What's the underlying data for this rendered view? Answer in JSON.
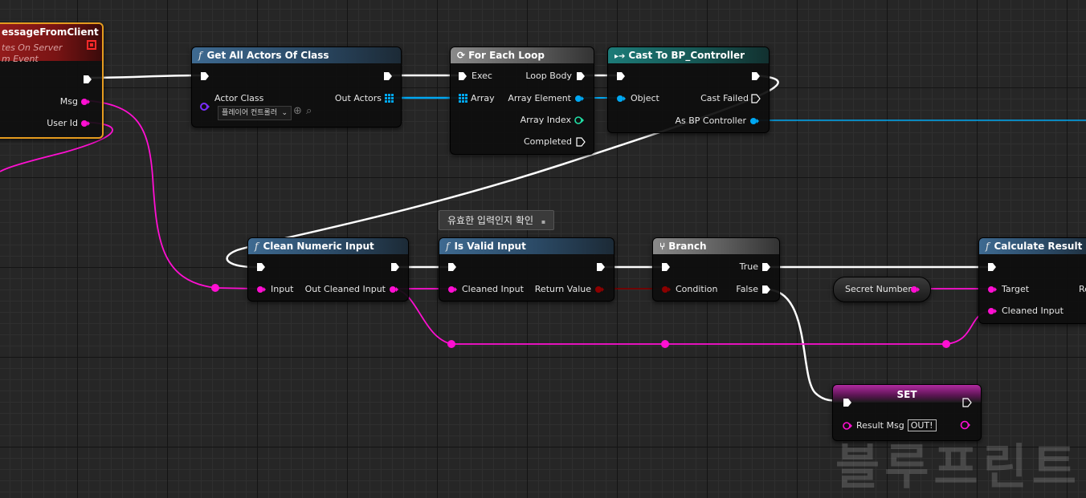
{
  "colors": {
    "exec": "#ffffff",
    "string": "#ff0fd2",
    "object": "#00a8f2",
    "int": "#21e0a6",
    "bool": "#8c0000",
    "class": "#5b00cc"
  },
  "event_node": {
    "title": "essageFromClient",
    "subtitle1": "tes On Server",
    "subtitle2": "m Event",
    "pin_msg": "Msg",
    "pin_user_id": "User Id"
  },
  "get_all_actors": {
    "title": "Get All Actors Of Class",
    "pin_actor_class": "Actor Class",
    "actor_class_value": "플레이어 컨트롤러",
    "pin_out_actors": "Out Actors"
  },
  "for_each": {
    "title": "For Each Loop",
    "pin_exec": "Exec",
    "pin_array": "Array",
    "pin_loop_body": "Loop Body",
    "pin_array_element": "Array Element",
    "pin_array_index": "Array Index",
    "pin_completed": "Completed"
  },
  "cast": {
    "title": "Cast To BP_Controller",
    "pin_object": "Object",
    "pin_cast_failed": "Cast Failed",
    "pin_as_bp": "As BP Controller"
  },
  "clean_input": {
    "title": "Clean Numeric Input",
    "pin_input": "Input",
    "pin_out_cleaned": "Out Cleaned Input"
  },
  "comment_tooltip": "유효한 입력인지 확인",
  "is_valid": {
    "title": "Is Valid Input",
    "pin_cleaned": "Cleaned Input",
    "pin_return": "Return Value"
  },
  "branch": {
    "title": "Branch",
    "pin_condition": "Condition",
    "pin_true": "True",
    "pin_false": "False"
  },
  "secret_number": {
    "label": "Secret Number"
  },
  "calculate": {
    "title": "Calculate Result",
    "pin_target": "Target",
    "pin_cleaned": "Cleaned Input",
    "pin_re": "Re"
  },
  "set_node": {
    "title": "SET",
    "pin_result": "Result Msg",
    "out_badge": "OUT!"
  },
  "watermark": "블루프린트"
}
